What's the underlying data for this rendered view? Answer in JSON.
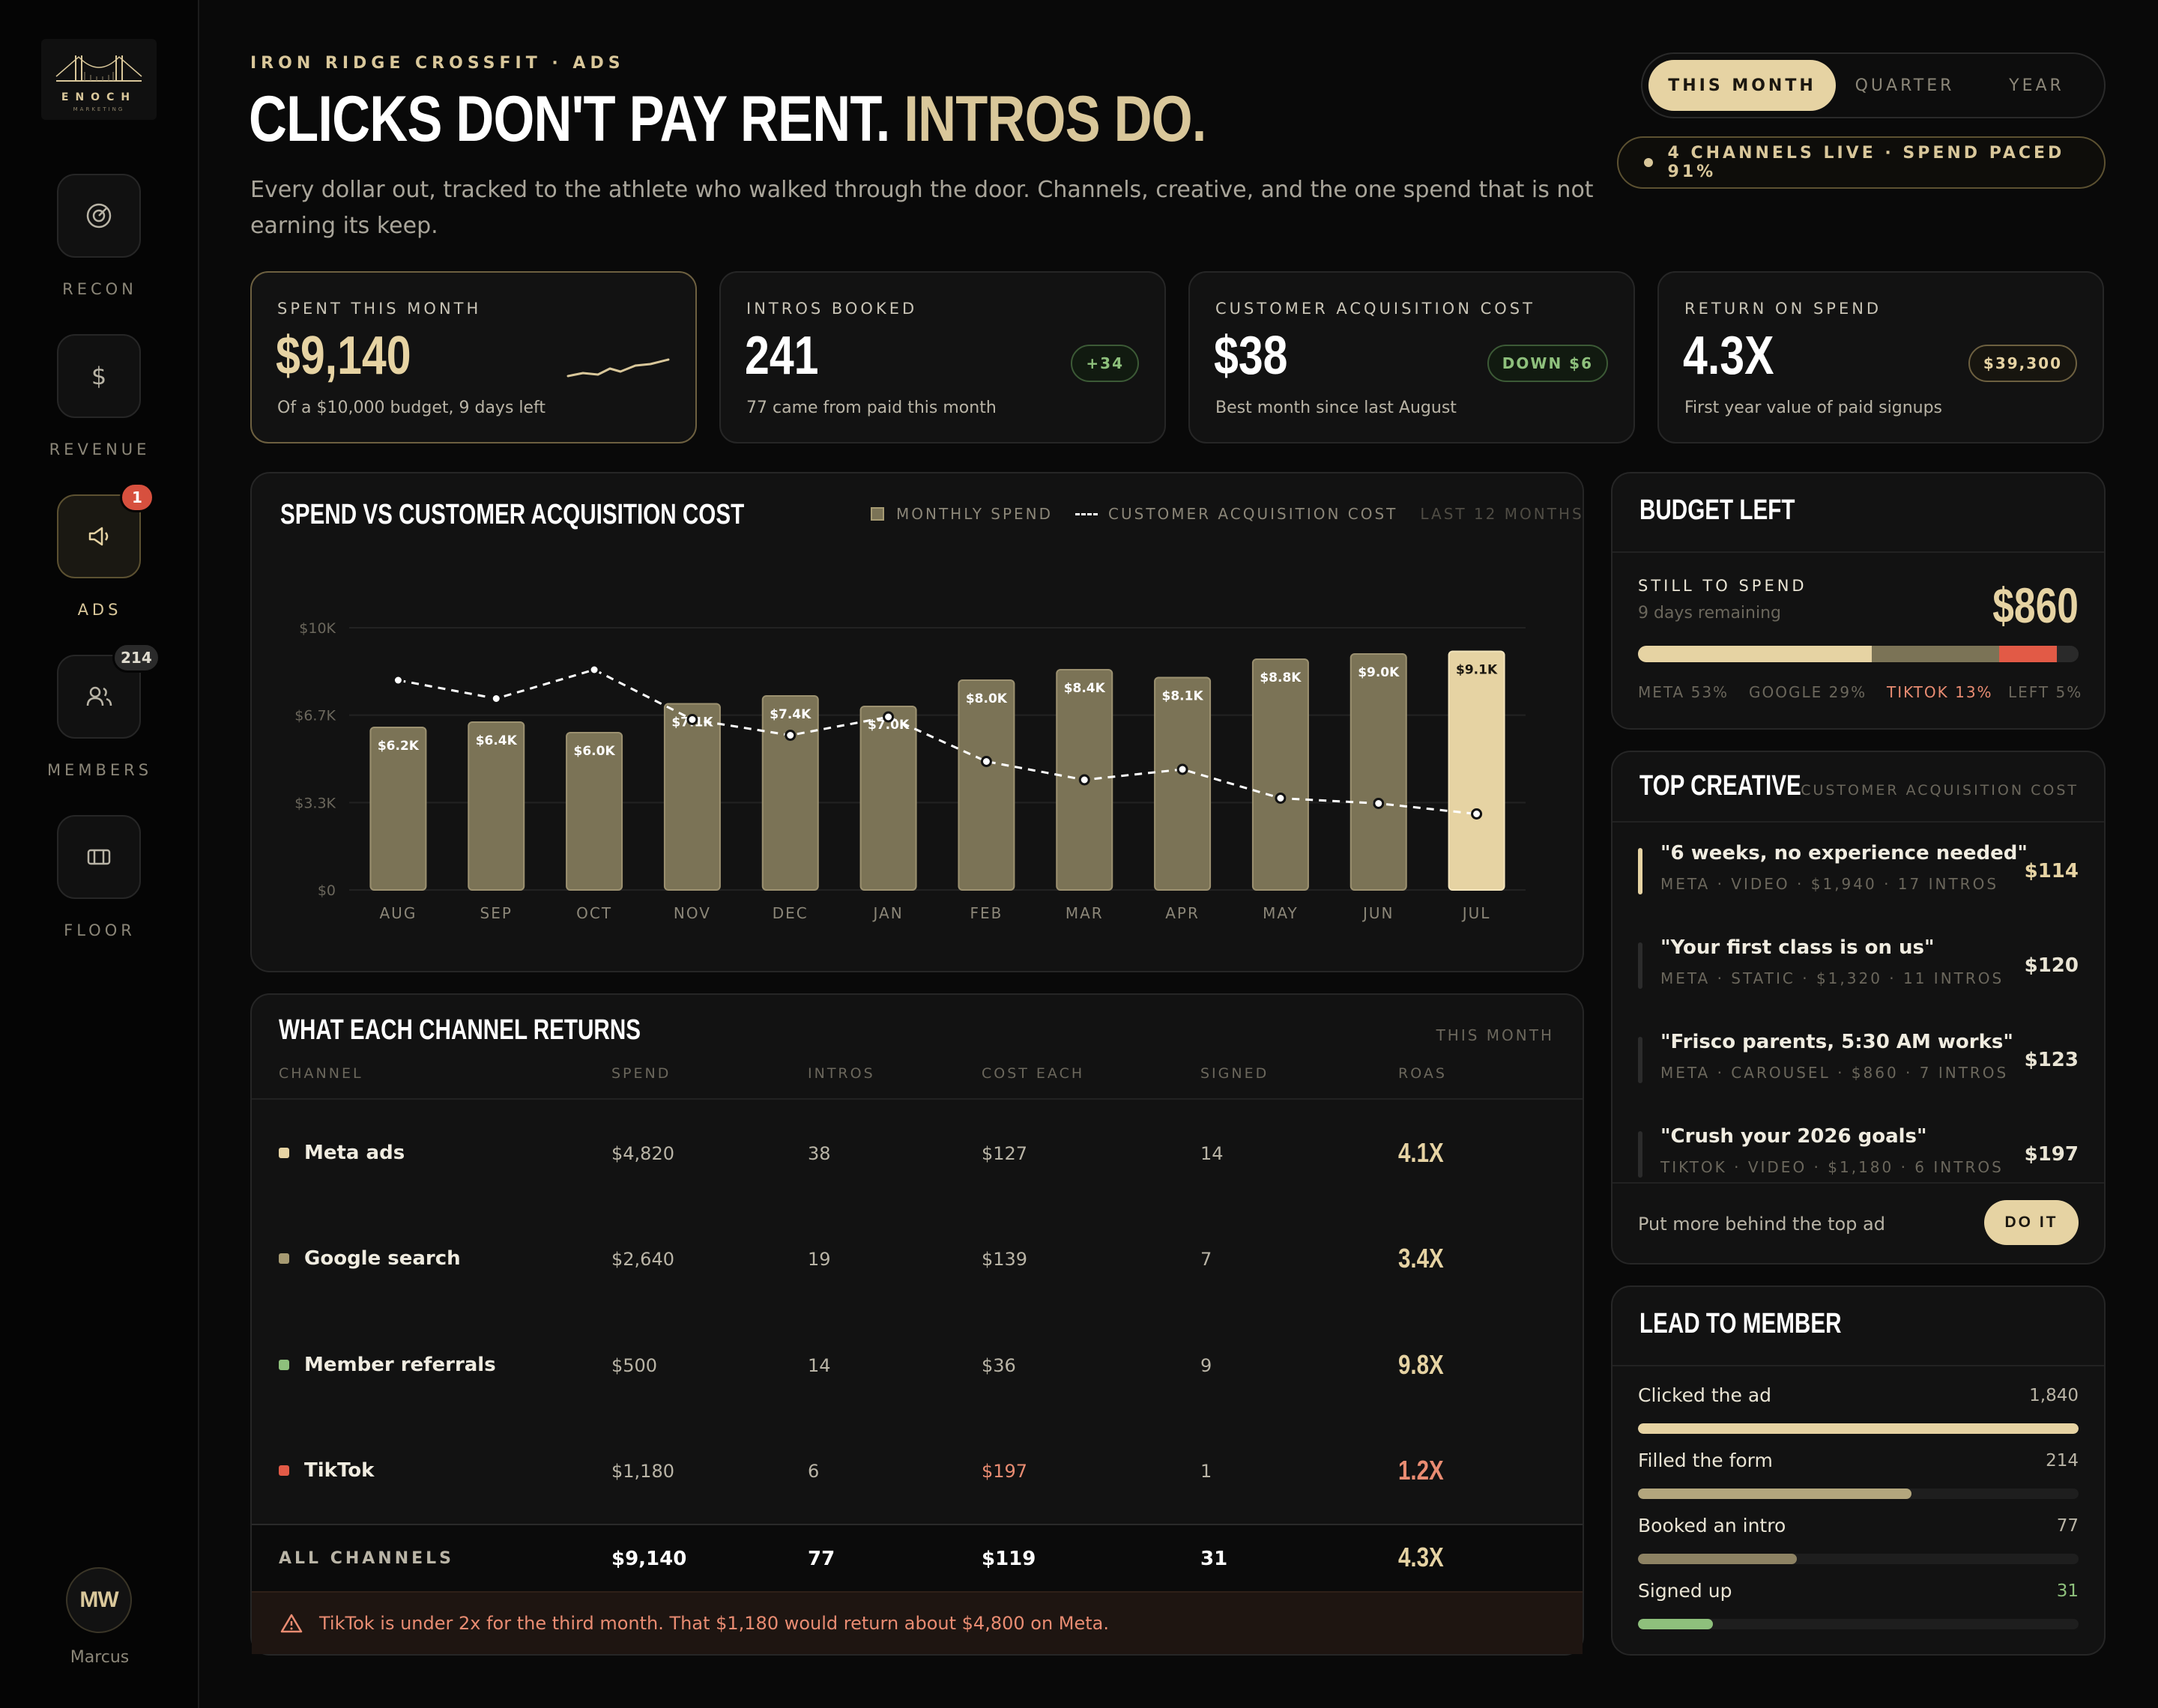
{
  "brand": {
    "logo_text": "ENOCH",
    "logo_sub": "MARKETING"
  },
  "sidebar": {
    "items": [
      {
        "label": "RECON",
        "icon": "target-icon"
      },
      {
        "label": "REVENUE",
        "icon": "dollar-icon"
      },
      {
        "label": "ADS",
        "icon": "megaphone-icon",
        "badge": "1",
        "active": true
      },
      {
        "label": "MEMBERS",
        "icon": "users-icon",
        "badge": "214"
      },
      {
        "label": "FLOOR",
        "icon": "floor-icon"
      }
    ],
    "user": {
      "initials": "MW",
      "name": "Marcus"
    }
  },
  "header": {
    "eyebrow": "IRON RIDGE CROSSFIT · ADS",
    "title_main": "CLICKS DON'T PAY RENT.",
    "title_accent": "INTROS DO.",
    "subtitle": "Every dollar out, tracked to the athlete who walked through the door. Channels, creative, and the one spend that is not earning its keep."
  },
  "period": {
    "options": [
      "THIS MONTH",
      "QUARTER",
      "YEAR"
    ],
    "selected": "THIS MONTH"
  },
  "status": "4 CHANNELS LIVE · SPEND PACED 91%",
  "kpis": [
    {
      "label": "SPENT THIS MONTH",
      "value": "$9,140",
      "sub": "Of a $10,000 budget, 9 days left"
    },
    {
      "label": "INTROS BOOKED",
      "value": "241",
      "sub": "77 came from paid this month",
      "badge": "+34"
    },
    {
      "label": "CUSTOMER ACQUISITION COST",
      "value": "$38",
      "sub": "Best month since last August",
      "badge": "DOWN $6"
    },
    {
      "label": "RETURN ON SPEND",
      "value": "4.3X",
      "sub": "First year value of paid signups",
      "badge": "$39,300"
    }
  ],
  "chart_panel": {
    "title": "SPEND VS CUSTOMER ACQUISITION COST",
    "legend_spend": "MONTHLY SPEND",
    "legend_cac": "CUSTOMER ACQUISITION COST",
    "range": "LAST 12 MONTHS"
  },
  "chart_data": {
    "type": "bar",
    "categories": [
      "AUG",
      "SEP",
      "OCT",
      "NOV",
      "DEC",
      "JAN",
      "FEB",
      "MAR",
      "APR",
      "MAY",
      "JUN",
      "JUL"
    ],
    "series": [
      {
        "name": "MONTHLY SPEND",
        "type": "bar",
        "values": [
          6200,
          6400,
          6000,
          7100,
          7400,
          7000,
          8000,
          8400,
          8100,
          8800,
          9000,
          9100
        ],
        "labels": [
          "$6.2K",
          "$6.4K",
          "$6.0K",
          "$7.1K",
          "$7.4K",
          "$7.0K",
          "$8.0K",
          "$8.4K",
          "$8.1K",
          "$8.8K",
          "$9.0K",
          "$9.1K"
        ]
      },
      {
        "name": "CUSTOMER ACQUISITION COST",
        "type": "line",
        "values": [
          8000,
          7300,
          8400,
          6500,
          5900,
          6600,
          4900,
          4200,
          4600,
          3500,
          3300,
          2900
        ]
      }
    ],
    "y_ticks": [
      "$0",
      "$3.3K",
      "$6.7K",
      "$10K"
    ],
    "ylim": [
      0,
      10000
    ],
    "highlight_index": 11
  },
  "channels": {
    "title": "WHAT EACH CHANNEL RETURNS",
    "period": "THIS MONTH",
    "headers": [
      "CHANNEL",
      "SPEND",
      "INTROS",
      "COST EACH",
      "SIGNED",
      "ROAS"
    ],
    "rows": [
      {
        "name": "Meta ads",
        "spend": "$4,820",
        "intros": "38",
        "cost": "$127",
        "signed": "14",
        "roas": "4.1X",
        "color": "#e6d3a3"
      },
      {
        "name": "Google search",
        "spend": "$2,640",
        "intros": "19",
        "cost": "$139",
        "signed": "7",
        "roas": "3.4X",
        "color": "#a69a72"
      },
      {
        "name": "Member referrals",
        "spend": "$500",
        "intros": "14",
        "cost": "$36",
        "signed": "9",
        "roas": "9.8X",
        "color": "#8ec07c"
      },
      {
        "name": "TikTok",
        "spend": "$1,180",
        "intros": "6",
        "cost": "$197",
        "signed": "1",
        "roas": "1.2X",
        "color": "#e25a46"
      }
    ],
    "total": {
      "label": "ALL CHANNELS",
      "spend": "$9,140",
      "intros": "77",
      "cost": "$119",
      "signed": "31",
      "roas": "4.3X"
    },
    "warning": "TikTok is under 2x for the third month. That $1,180 would return about $4,800 on Meta."
  },
  "budget": {
    "title": "BUDGET LEFT",
    "label": "STILL TO SPEND",
    "sub": "9 days remaining",
    "value": "$860",
    "segments": [
      {
        "label": "META 53%",
        "share": 53,
        "color": "#e6d3a3"
      },
      {
        "label": "GOOGLE 29%",
        "share": 29,
        "color": "#7b7356"
      },
      {
        "label": "TIKTOK 13%",
        "share": 13,
        "color": "#e25a46"
      },
      {
        "label": "LEFT 5%",
        "share": 5,
        "color": "#2a2a2a"
      }
    ]
  },
  "creative": {
    "title": "TOP CREATIVE",
    "meta": "CUSTOMER ACQUISITION COST",
    "items": [
      {
        "title": "\"6 weeks, no experience needed\"",
        "meta": "META · VIDEO · $1,940 · 17 INTROS",
        "cost": "$114"
      },
      {
        "title": "\"Your first class is on us\"",
        "meta": "META · STATIC · $1,320 · 11 INTROS",
        "cost": "$120"
      },
      {
        "title": "\"Frisco parents, 5:30 AM works\"",
        "meta": "META · CAROUSEL · $860 · 7 INTROS",
        "cost": "$123"
      },
      {
        "title": "\"Crush your 2026 goals\"",
        "meta": "TIKTOK · VIDEO · $1,180 · 6 INTROS",
        "cost": "$197"
      }
    ],
    "footer": "Put more behind the top ad",
    "action": "DO IT"
  },
  "funnel": {
    "title": "LEAD TO MEMBER",
    "steps": [
      {
        "label": "Clicked the ad",
        "value": "1,840",
        "fraction": 1.0,
        "color": "#e6d3a3"
      },
      {
        "label": "Filled the form",
        "value": "214",
        "fraction": 0.62,
        "color": "#b3a67d"
      },
      {
        "label": "Booked an intro",
        "value": "77",
        "fraction": 0.36,
        "color": "#8d8263"
      },
      {
        "label": "Signed up",
        "value": "31",
        "fraction": 0.17,
        "color": "#8ec07c"
      }
    ]
  }
}
